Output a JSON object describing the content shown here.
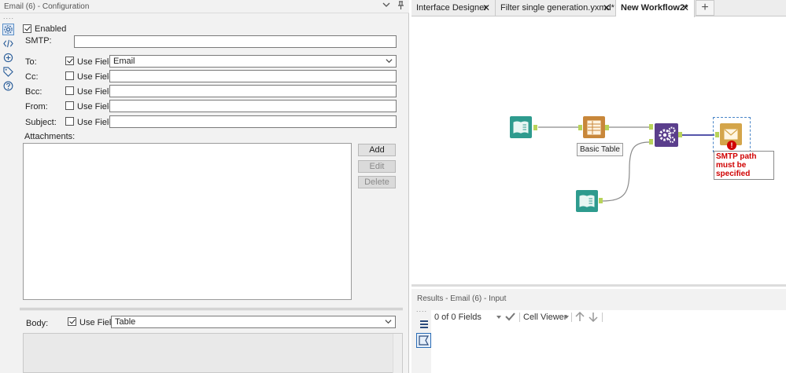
{
  "config": {
    "title": "Email (6) - Configuration",
    "dots": "....",
    "enabled_label": "Enabled",
    "smtp_label": "SMTP:",
    "smtp_value": "",
    "fields": [
      {
        "label": "To:",
        "use_field_label": "Use Field",
        "checked": true,
        "value": "Email",
        "dropdown": true
      },
      {
        "label": "Cc:",
        "use_field_label": "Use Field",
        "checked": false,
        "value": ""
      },
      {
        "label": "Bcc:",
        "use_field_label": "Use Field",
        "checked": false,
        "value": ""
      },
      {
        "label": "From:",
        "use_field_label": "Use Field",
        "checked": false,
        "value": ""
      },
      {
        "label": "Subject:",
        "use_field_label": "Use Field",
        "checked": false,
        "value": ""
      }
    ],
    "attachments_label": "Attachments:",
    "add_label": "Add",
    "edit_label": "Edit",
    "delete_label": "Delete",
    "body_label": "Body:",
    "body_use_field_label": "Use Field",
    "body_value": "Table"
  },
  "tabs": [
    {
      "label": "Interface Designer",
      "close": "✕"
    },
    {
      "label": "Filter single generation.yxmd*",
      "close": "✕"
    },
    {
      "label": "New Workflow2*",
      "close": "✕"
    }
  ],
  "tab_add": "+",
  "canvas": {
    "basic_table_label": "Basic Table",
    "error_text": "SMTP path must be specified",
    "error_mark": "!",
    "accent_input": "#2e9b8e",
    "accent_report": "#c8873a",
    "accent_macro": "#5a3e8c",
    "accent_email": "#d4a54a"
  },
  "results": {
    "title": "Results - Email (6) - Input",
    "dots": "....",
    "fields_count": "0 of 0 Fields",
    "cell_viewer": "Cell Viewer"
  }
}
